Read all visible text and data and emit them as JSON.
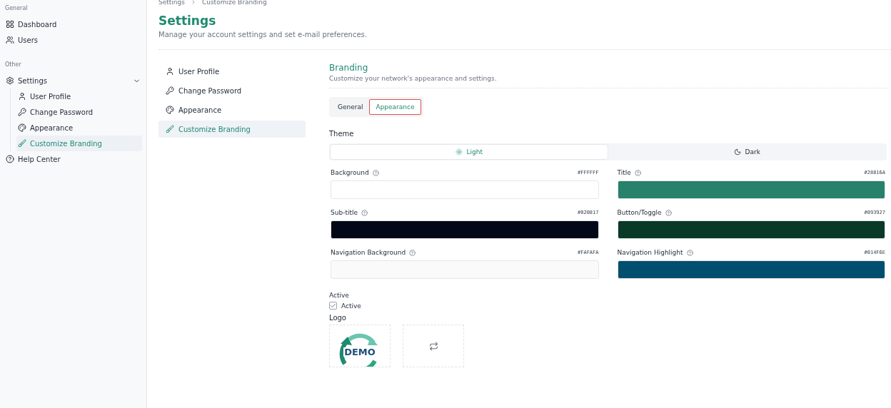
{
  "sidebar": {
    "sections": [
      {
        "heading": "General",
        "items": [
          {
            "label": "Dashboard",
            "kind": "dashboard",
            "selected": false
          },
          {
            "label": "Users",
            "kind": "users",
            "selected": false
          }
        ]
      },
      {
        "heading": "Other",
        "items": [
          {
            "label": "Settings",
            "kind": "settings",
            "selected": false,
            "expanded": true,
            "children": [
              {
                "label": "User Profile",
                "kind": "user",
                "selected": false
              },
              {
                "label": "Change Password",
                "kind": "key",
                "selected": false
              },
              {
                "label": "Appearance",
                "kind": "palette",
                "selected": false
              },
              {
                "label": "Customize Branding",
                "kind": "brush",
                "selected": true
              }
            ]
          },
          {
            "label": "Help Center",
            "kind": "help",
            "selected": false
          }
        ]
      }
    ]
  },
  "breadcrumb": [
    "Settings",
    "Customize Branding"
  ],
  "page": {
    "title": "Settings",
    "subtitle": "Manage your account settings and set e-mail preferences."
  },
  "settings_nav": [
    {
      "label": "User Profile",
      "kind": "user",
      "selected": false
    },
    {
      "label": "Change Password",
      "kind": "key",
      "selected": false
    },
    {
      "label": "Appearance",
      "kind": "palette",
      "selected": false
    },
    {
      "label": "Customize Branding",
      "kind": "brush",
      "selected": true
    }
  ],
  "section": {
    "title": "Branding",
    "subtitle": "Customize your network's appearance and settings."
  },
  "tabs": [
    {
      "label": "General",
      "selected": false
    },
    {
      "label": "Appearance",
      "selected": true
    }
  ],
  "theme": {
    "label": "Theme",
    "options": [
      {
        "label": "Light",
        "kind": "sun",
        "selected": true
      },
      {
        "label": "Dark",
        "kind": "moon",
        "selected": false
      }
    ]
  },
  "colors": [
    {
      "label": "Background",
      "hex": "#FFFFFF",
      "color": "#ffffff"
    },
    {
      "label": "Title",
      "hex": "#28816A",
      "color": "#28816a"
    },
    {
      "label": "Sub-title",
      "hex": "#020817",
      "color": "#020817"
    },
    {
      "label": "Button/Toggle",
      "hex": "#093927",
      "color": "#093927"
    },
    {
      "label": "Navigation Background",
      "hex": "#FAFAFA",
      "color": "#fafafa"
    },
    {
      "label": "Navigation Highlight",
      "hex": "#014F6E",
      "color": "#014f6e"
    }
  ],
  "active": {
    "heading": "Active",
    "label": "Active",
    "checked": true
  },
  "logo": {
    "heading": "Logo",
    "text": "DEMO"
  }
}
